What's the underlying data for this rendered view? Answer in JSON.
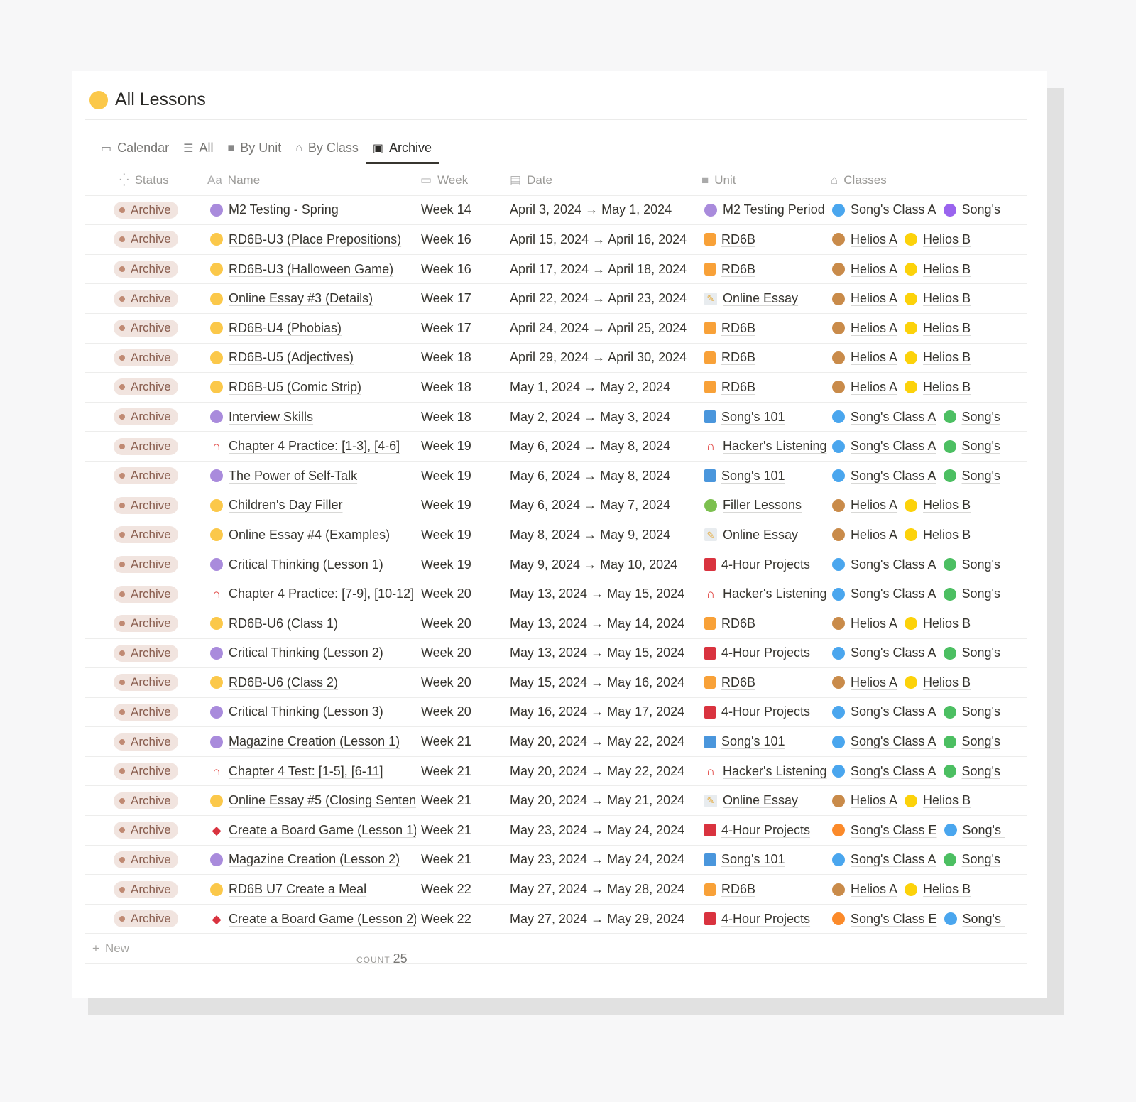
{
  "page": {
    "title": "All Lessons",
    "title_icon": "yellow-circle"
  },
  "tabs": [
    {
      "label": "Calendar",
      "icon": "calendar-icon"
    },
    {
      "label": "All",
      "icon": "list-icon"
    },
    {
      "label": "By Unit",
      "icon": "folder-icon"
    },
    {
      "label": "By Class",
      "icon": "school-icon"
    },
    {
      "label": "Archive",
      "icon": "archive-icon",
      "active": true
    }
  ],
  "columns": {
    "status": "Status",
    "name": "Name",
    "week": "Week",
    "date": "Date",
    "unit": "Unit",
    "classes": "Classes"
  },
  "rows": [
    {
      "status": "Archive",
      "name": "M2 Testing - Spring",
      "ni": "dot-purple",
      "week": "Week 14",
      "date": "April 3, 2024 → May 1, 2024",
      "unit": "M2 Testing Period",
      "ui": "dot-purple",
      "c1": "Song's Class A",
      "c1i": "c-blue",
      "c2": "Song's",
      "c2i": "c-purple"
    },
    {
      "status": "Archive",
      "name": "RD6B-U3 (Place Prepositions)",
      "ni": "dot-yellow",
      "week": "Week 16",
      "date": "April 15, 2024 → April 16, 2024",
      "unit": "RD6B",
      "ui": "sq-orange",
      "c1": "Helios A",
      "c1i": "c-brown",
      "c2": "Helios B",
      "c2i": "c-yellow"
    },
    {
      "status": "Archive",
      "name": "RD6B-U3 (Halloween Game)",
      "ni": "dot-yellow",
      "week": "Week 16",
      "date": "April 17, 2024 → April 18, 2024",
      "unit": "RD6B",
      "ui": "sq-orange",
      "c1": "Helios A",
      "c1i": "c-brown",
      "c2": "Helios B",
      "c2i": "c-yellow"
    },
    {
      "status": "Archive",
      "name": "Online Essay #3 (Details)",
      "ni": "dot-yellow",
      "week": "Week 17",
      "date": "April 22, 2024 → April 23, 2024",
      "unit": "Online Essay",
      "ui": "memo",
      "c1": "Helios A",
      "c1i": "c-brown",
      "c2": "Helios B",
      "c2i": "c-yellow"
    },
    {
      "status": "Archive",
      "name": "RD6B-U4 (Phobias)",
      "ni": "dot-yellow",
      "week": "Week 17",
      "date": "April 24, 2024 → April 25, 2024",
      "unit": "RD6B",
      "ui": "sq-orange",
      "c1": "Helios A",
      "c1i": "c-brown",
      "c2": "Helios B",
      "c2i": "c-yellow"
    },
    {
      "status": "Archive",
      "name": "RD6B-U5 (Adjectives)",
      "ni": "dot-yellow",
      "week": "Week 18",
      "date": "April 29, 2024 → April 30, 2024",
      "unit": "RD6B",
      "ui": "sq-orange",
      "c1": "Helios A",
      "c1i": "c-brown",
      "c2": "Helios B",
      "c2i": "c-yellow"
    },
    {
      "status": "Archive",
      "name": "RD6B-U5 (Comic Strip)",
      "ni": "dot-yellow",
      "week": "Week 18",
      "date": "May 1, 2024 → May 2, 2024",
      "unit": "RD6B",
      "ui": "sq-orange",
      "c1": "Helios A",
      "c1i": "c-brown",
      "c2": "Helios B",
      "c2i": "c-yellow"
    },
    {
      "status": "Archive",
      "name": "Interview Skills",
      "ni": "dot-purple",
      "week": "Week 18",
      "date": "May 2, 2024 → May 3, 2024",
      "unit": "Song's 101",
      "ui": "book-blue",
      "c1": "Song's Class A",
      "c1i": "c-blue",
      "c2": "Song's",
      "c2i": "c-green"
    },
    {
      "status": "Archive",
      "name": "Chapter 4 Practice: [1-3], [4-6]",
      "ni": "headphones",
      "week": "Week 19",
      "date": "May 6, 2024 → May 8, 2024",
      "unit": "Hacker's Listening",
      "ui": "headphones",
      "c1": "Song's Class A",
      "c1i": "c-blue",
      "c2": "Song's",
      "c2i": "c-green"
    },
    {
      "status": "Archive",
      "name": "The Power of Self-Talk",
      "ni": "dot-purple",
      "week": "Week 19",
      "date": "May 6, 2024 → May 8, 2024",
      "unit": "Song's 101",
      "ui": "book-blue",
      "c1": "Song's Class A",
      "c1i": "c-blue",
      "c2": "Song's",
      "c2i": "c-green"
    },
    {
      "status": "Archive",
      "name": "Children's Day Filler",
      "ni": "dot-yellow",
      "week": "Week 19",
      "date": "May 6, 2024 → May 7, 2024",
      "unit": "Filler Lessons",
      "ui": "apple",
      "c1": "Helios A",
      "c1i": "c-brown",
      "c2": "Helios B",
      "c2i": "c-yellow"
    },
    {
      "status": "Archive",
      "name": "Online Essay #4 (Examples)",
      "ni": "dot-yellow",
      "week": "Week 19",
      "date": "May 8, 2024 → May 9, 2024",
      "unit": "Online Essay",
      "ui": "memo",
      "c1": "Helios A",
      "c1i": "c-brown",
      "c2": "Helios B",
      "c2i": "c-yellow"
    },
    {
      "status": "Archive",
      "name": "Critical Thinking (Lesson 1)",
      "ni": "dot-purple",
      "week": "Week 19",
      "date": "May 9, 2024 → May 10, 2024",
      "unit": "4-Hour Projects",
      "ui": "book-red",
      "c1": "Song's Class A",
      "c1i": "c-blue",
      "c2": "Song's",
      "c2i": "c-green"
    },
    {
      "status": "Archive",
      "name": "Chapter 4 Practice: [7-9], [10-12]",
      "ni": "headphones",
      "week": "Week 20",
      "date": "May 13, 2024 → May 15, 2024",
      "unit": "Hacker's Listening",
      "ui": "headphones",
      "c1": "Song's Class A",
      "c1i": "c-blue",
      "c2": "Song's",
      "c2i": "c-green"
    },
    {
      "status": "Archive",
      "name": "RD6B-U6 (Class 1)",
      "ni": "dot-yellow",
      "week": "Week 20",
      "date": "May 13, 2024 → May 14, 2024",
      "unit": "RD6B",
      "ui": "sq-orange",
      "c1": "Helios A",
      "c1i": "c-brown",
      "c2": "Helios B",
      "c2i": "c-yellow"
    },
    {
      "status": "Archive",
      "name": "Critical Thinking (Lesson 2)",
      "ni": "dot-purple",
      "week": "Week 20",
      "date": "May 13, 2024 → May 15, 2024",
      "unit": "4-Hour Projects",
      "ui": "book-red",
      "c1": "Song's Class A",
      "c1i": "c-blue",
      "c2": "Song's",
      "c2i": "c-green"
    },
    {
      "status": "Archive",
      "name": "RD6B-U6 (Class 2)",
      "ni": "dot-yellow",
      "week": "Week 20",
      "date": "May 15, 2024 → May 16, 2024",
      "unit": "RD6B",
      "ui": "sq-orange",
      "c1": "Helios A",
      "c1i": "c-brown",
      "c2": "Helios B",
      "c2i": "c-yellow"
    },
    {
      "status": "Archive",
      "name": "Critical Thinking (Lesson 3)",
      "ni": "dot-purple",
      "week": "Week 20",
      "date": "May 16, 2024 → May 17, 2024",
      "unit": "4-Hour Projects",
      "ui": "book-red",
      "c1": "Song's Class A",
      "c1i": "c-blue",
      "c2": "Song's",
      "c2i": "c-green"
    },
    {
      "status": "Archive",
      "name": "Magazine Creation (Lesson 1)",
      "ni": "dot-purple",
      "week": "Week 21",
      "date": "May 20, 2024 → May 22, 2024",
      "unit": "Song's 101",
      "ui": "book-blue",
      "c1": "Song's Class A",
      "c1i": "c-blue",
      "c2": "Song's",
      "c2i": "c-green"
    },
    {
      "status": "Archive",
      "name": "Chapter 4 Test: [1-5], [6-11]",
      "ni": "headphones",
      "week": "Week 21",
      "date": "May 20, 2024 → May 22, 2024",
      "unit": "Hacker's Listening",
      "ui": "headphones",
      "c1": "Song's Class A",
      "c1i": "c-blue",
      "c2": "Song's",
      "c2i": "c-green"
    },
    {
      "status": "Archive",
      "name": "Online Essay #5 (Closing Sentenc",
      "ni": "dot-yellow",
      "week": "Week 21",
      "date": "May 20, 2024 → May 21, 2024",
      "unit": "Online Essay",
      "ui": "memo",
      "c1": "Helios A",
      "c1i": "c-brown",
      "c2": "Helios B",
      "c2i": "c-yellow"
    },
    {
      "status": "Archive",
      "name": "Create a Board Game (Lesson 1)",
      "ni": "dice",
      "week": "Week 21",
      "date": "May 23, 2024 → May 24, 2024",
      "unit": "4-Hour Projects",
      "ui": "book-red",
      "c1": "Song's Class E",
      "c1i": "c-orange",
      "c2": "Song's (",
      "c2i": "c-blue"
    },
    {
      "status": "Archive",
      "name": "Magazine Creation (Lesson 2)",
      "ni": "dot-purple",
      "week": "Week 21",
      "date": "May 23, 2024 → May 24, 2024",
      "unit": "Song's 101",
      "ui": "book-blue",
      "c1": "Song's Class A",
      "c1i": "c-blue",
      "c2": "Song's",
      "c2i": "c-green"
    },
    {
      "status": "Archive",
      "name": "RD6B U7 Create a Meal",
      "ni": "dot-yellow",
      "week": "Week 22",
      "date": "May 27, 2024 → May 28, 2024",
      "unit": "RD6B",
      "ui": "sq-orange",
      "c1": "Helios A",
      "c1i": "c-brown",
      "c2": "Helios B",
      "c2i": "c-yellow"
    },
    {
      "status": "Archive",
      "name": "Create a Board Game (Lesson 2)",
      "ni": "dice",
      "week": "Week 22",
      "date": "May 27, 2024 → May 29, 2024",
      "unit": "4-Hour Projects",
      "ui": "book-red",
      "c1": "Song's Class E",
      "c1i": "c-orange",
      "c2": "Song's (",
      "c2i": "c-blue"
    }
  ],
  "footer": {
    "new_label": "New",
    "count_label": "COUNT",
    "count_value": "25"
  },
  "colors": {
    "status_pill": "#f1e4df",
    "status_text": "#8a5e4f",
    "accent_yellow": "#fbc84a"
  }
}
